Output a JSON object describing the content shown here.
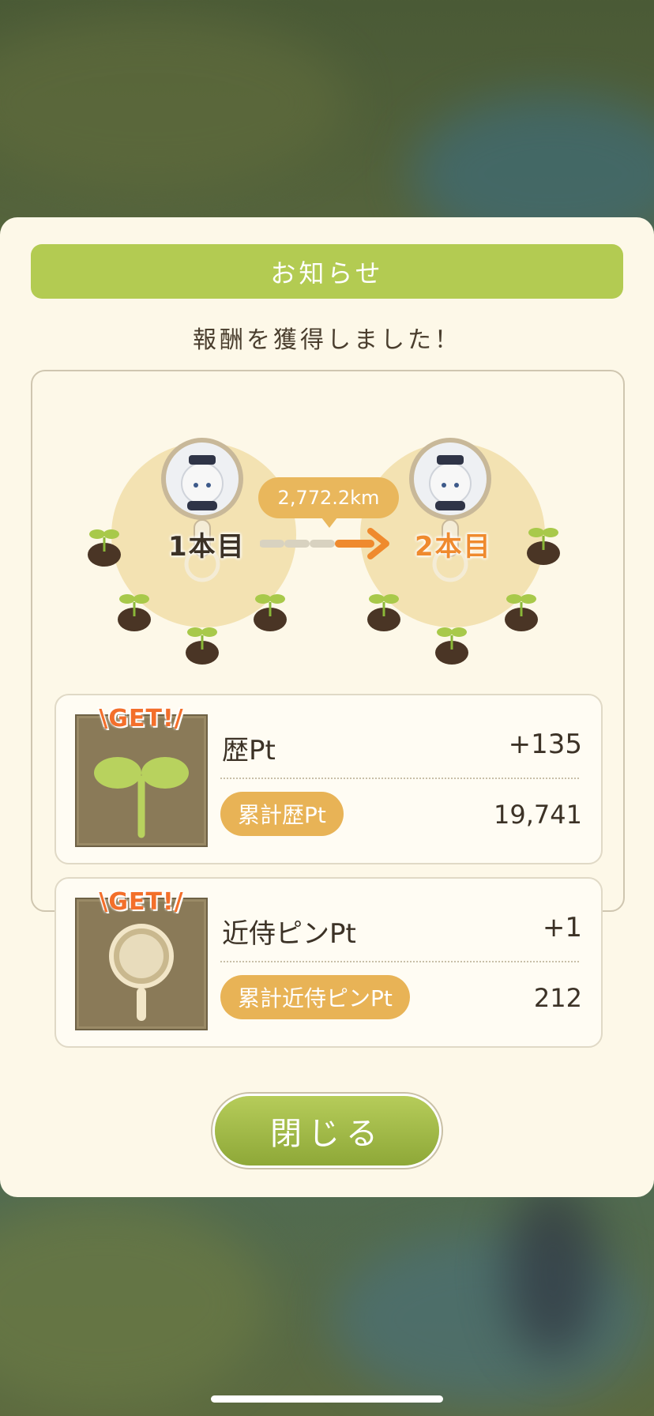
{
  "dialog": {
    "title": "お知らせ",
    "subtitle": "報酬を獲得しました！",
    "close_label": "閉じる"
  },
  "progress": {
    "from_label": "1本目",
    "to_label": "2本目",
    "distance": "2,772.2km"
  },
  "rewards": [
    {
      "badge": "\\GET!/",
      "name": "歴Pt",
      "value": "+135",
      "total_label": "累計歴Pt",
      "total_value": "19,741",
      "icon": "sprout-icon"
    },
    {
      "badge": "\\GET!/",
      "name": "近侍ピンPt",
      "value": "+1",
      "total_label": "累計近侍ピンPt",
      "total_value": "212",
      "icon": "pin-icon"
    }
  ],
  "colors": {
    "title_bar": "#b3cb52",
    "pill": "#e8b356",
    "accent_orange": "#ef8a2e",
    "modal_bg": "#fdf8e8"
  }
}
